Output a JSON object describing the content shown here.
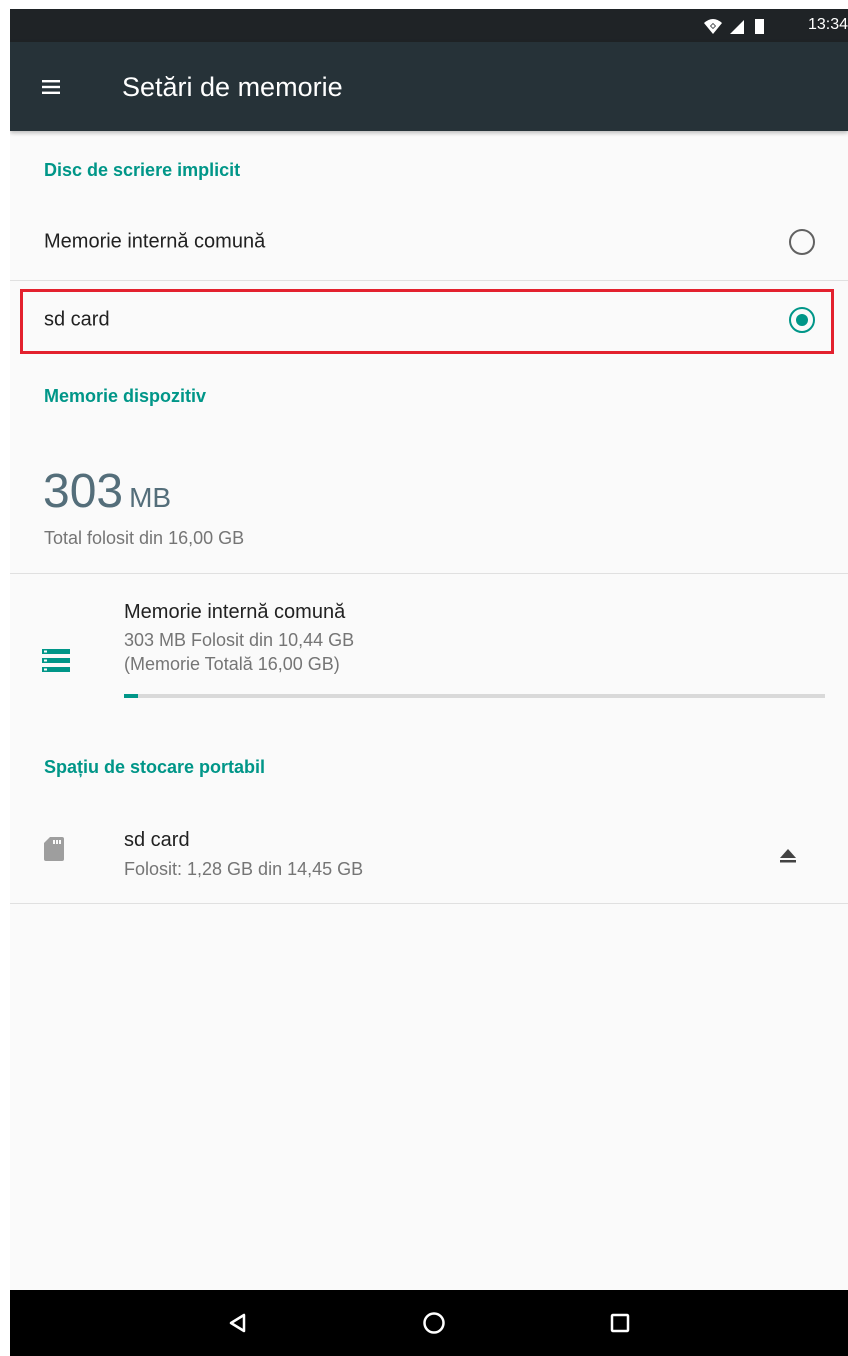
{
  "status_bar": {
    "time": "13:34"
  },
  "app_bar": {
    "title": "Setări de memorie"
  },
  "default_disk": {
    "header": "Disc de scriere implicit",
    "options": [
      {
        "label": "Memorie internă comună",
        "selected": false
      },
      {
        "label": "sd card",
        "selected": true
      }
    ]
  },
  "device_storage": {
    "header": "Memorie dispozitiv",
    "used_value": "303",
    "used_unit": "MB",
    "total_text": "Total folosit din 16,00 GB",
    "internal": {
      "title": "Memorie internă comună",
      "line1": "303 MB Folosit din 10,44 GB",
      "line2": "(Memorie Totală 16,00 GB)",
      "progress_fraction": 0.02
    }
  },
  "portable_storage": {
    "header": "Spațiu de stocare portabil",
    "sd": {
      "title": "sd card",
      "subtitle": "Folosit: 1,28 GB din 14,45 GB"
    }
  },
  "icons": {
    "menu": "menu-icon",
    "storage": "storage-icon",
    "sd": "sd-card-icon",
    "eject": "eject-icon",
    "back": "back-icon",
    "home": "home-icon",
    "recents": "recents-icon"
  },
  "colors": {
    "accent": "#009688",
    "app_bar": "#263238",
    "highlight": "#e3212e"
  }
}
